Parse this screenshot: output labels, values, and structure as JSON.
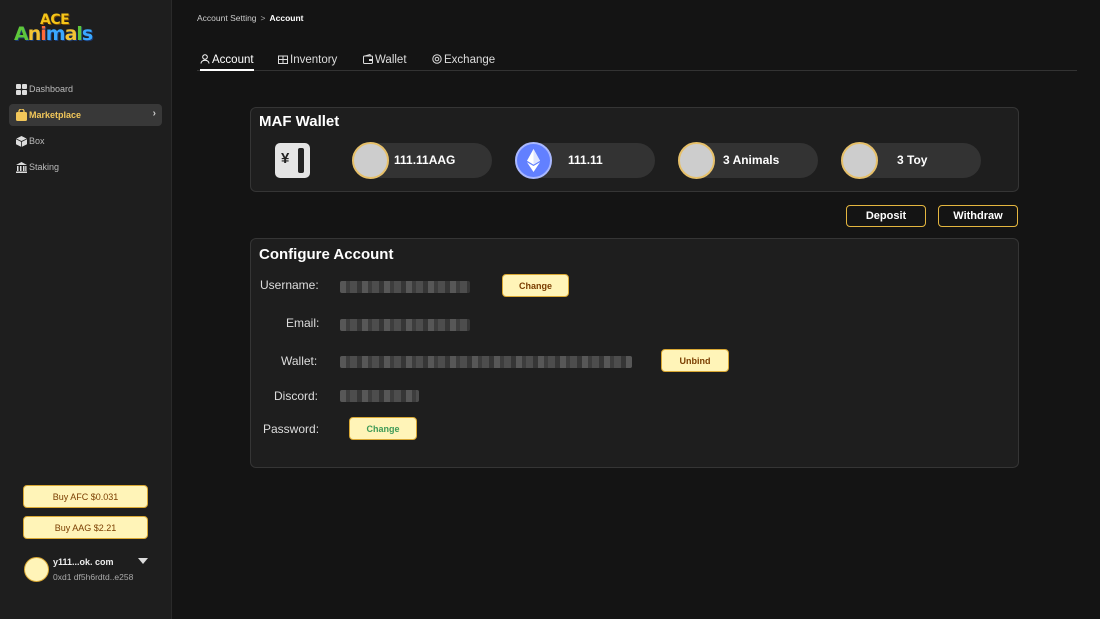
{
  "logo": {
    "line1": "ACE",
    "line2": "Animals"
  },
  "sidebar": {
    "items": [
      {
        "label": "Dashboard",
        "icon": "grid-icon"
      },
      {
        "label": "Marketplace",
        "icon": "bag-icon",
        "active": true
      },
      {
        "label": "Box",
        "icon": "cube-icon"
      },
      {
        "label": "Staking",
        "icon": "bank-icon"
      }
    ],
    "buy_afc": "Buy AFC $0.031",
    "buy_aag": "Buy AAG $2.21",
    "user": {
      "name": "y111...ok. com",
      "address": "0xd1 df5h6rdtd..e258"
    }
  },
  "breadcrumb": {
    "parent": "Account Setting",
    "separator": ">",
    "current": "Account"
  },
  "tabs": [
    {
      "label": "Account",
      "icon": "user-icon",
      "active": true
    },
    {
      "label": "Inventory",
      "icon": "inventory-icon"
    },
    {
      "label": "Wallet",
      "icon": "wallet-icon"
    },
    {
      "label": "Exchange",
      "icon": "exchange-icon"
    }
  ],
  "maf_wallet": {
    "title": "MAF Wallet",
    "balances": [
      {
        "label": "111.11AAG",
        "icon": "aag-coin-icon"
      },
      {
        "label": "111.11",
        "icon": "ethereum-icon"
      },
      {
        "label": "3 Animals",
        "icon": "animal-icon"
      },
      {
        "label": "3 Toy",
        "icon": "toy-icon"
      }
    ],
    "deposit": "Deposit",
    "withdraw": "Withdraw"
  },
  "configure": {
    "title": "Configure Account",
    "username_label": "Username:",
    "email_label": "Email:",
    "wallet_label": "Wallet:",
    "discord_label": "Discord:",
    "password_label": "Password:",
    "change_username": "Change",
    "unbind": "Unbind",
    "change_password": "Change"
  },
  "colors": {
    "accent": "#e4b63f",
    "button_fill": "#fff4b8",
    "background": "#141414",
    "card": "#1e1e1e",
    "eth": "#6280ff"
  }
}
